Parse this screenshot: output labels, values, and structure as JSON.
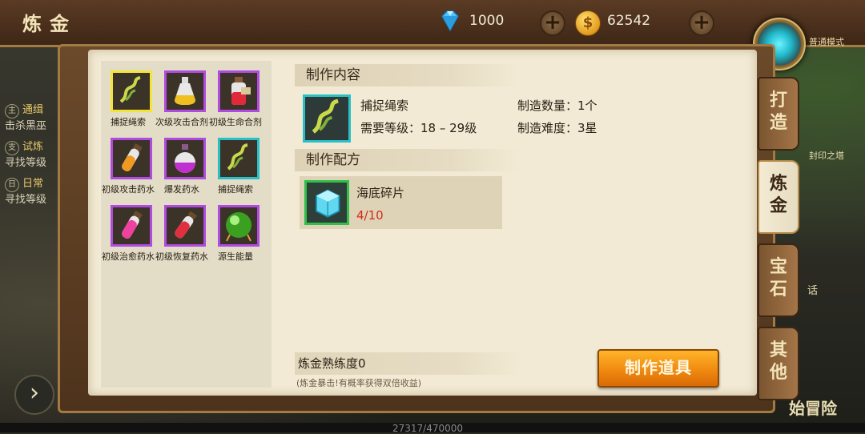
{
  "header": {
    "title": "炼金",
    "gems": "1000",
    "coins": "62542"
  },
  "background": {
    "quests": [
      {
        "tag": "主",
        "title": "通缉",
        "desc": "击杀黑巫"
      },
      {
        "tag": "支",
        "title": "试炼",
        "desc": "寻找等级"
      },
      {
        "tag": "日",
        "title": "日常",
        "desc": "寻找等级"
      }
    ],
    "mode_label": "普通模式",
    "tower_label": "封印之塔",
    "talk_label": "话",
    "adventure_label": "始冒险",
    "xp": "27317/470000"
  },
  "items": [
    {
      "name": "捕捉绳索",
      "icon": "rope-icon"
    },
    {
      "name": "次级攻击合剂",
      "icon": "yellow-potion-icon"
    },
    {
      "name": "初级生命合剂",
      "icon": "red-potion-icon"
    },
    {
      "name": "初级攻击药水",
      "icon": "orange-vial-icon"
    },
    {
      "name": "爆发药水",
      "icon": "purple-flask-icon"
    },
    {
      "name": "捕捉绳索",
      "icon": "rope-icon"
    },
    {
      "name": "初级治愈药水",
      "icon": "pink-vial-icon"
    },
    {
      "name": "初级恢复药水",
      "icon": "red-vial-icon"
    },
    {
      "name": "源生能量",
      "icon": "green-orb-icon"
    }
  ],
  "detail": {
    "content_title": "制作内容",
    "product_name": "捕捉绳索",
    "level_req": "需要等级：18 – 29级",
    "make_count": "制造数量：1个",
    "make_difficulty": "制造难度：3星",
    "recipe_title": "制作配方",
    "material_name": "海底碎片",
    "material_count": "4/10",
    "proficiency": "炼金熟练度0",
    "note": "(炼金暴击!有概率获得双倍收益)",
    "make_button": "制作道具"
  },
  "tabs": [
    {
      "label": "打造",
      "active": false
    },
    {
      "label": "炼金",
      "active": true
    },
    {
      "label": "宝石",
      "active": false
    },
    {
      "label": "其他",
      "active": false
    }
  ]
}
